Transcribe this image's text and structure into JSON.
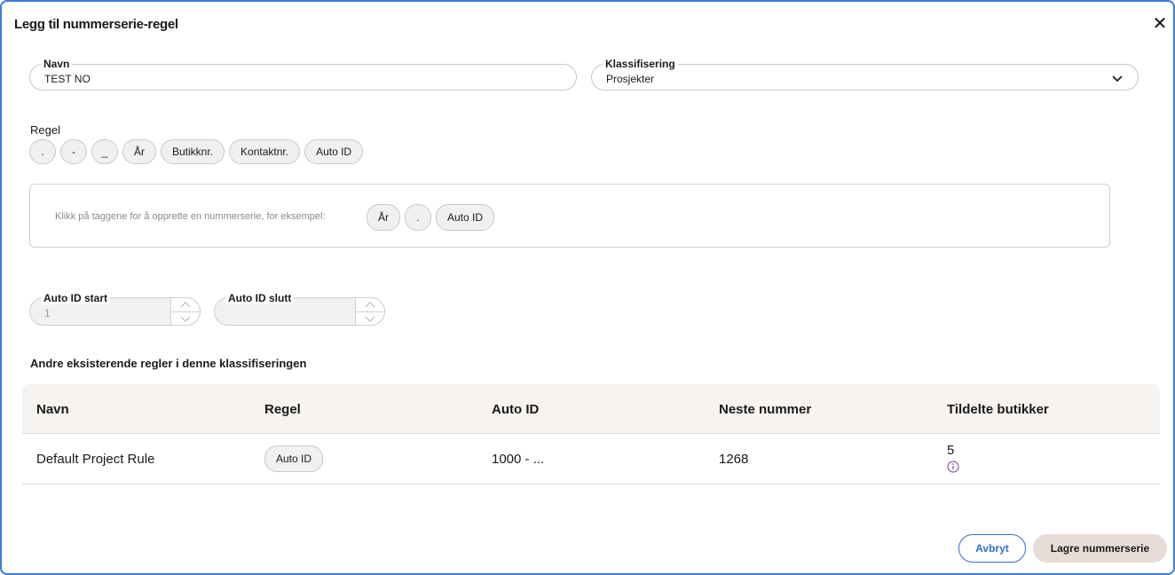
{
  "dialog": {
    "title": "Legg til nummerserie-regel",
    "close_icon": "close-icon"
  },
  "form": {
    "name": {
      "label": "Navn",
      "value": "TEST NO"
    },
    "classification": {
      "label": "Klassifisering",
      "value": "Prosjekter"
    }
  },
  "rule": {
    "label": "Regel",
    "tags": [
      ".",
      "-",
      "_",
      "År",
      "Butikknr.",
      "Kontaktnr.",
      "Auto ID"
    ],
    "hint": "Klikk på taggene for å opprette en nummerserie, for eksempel:",
    "example_tags": [
      "År",
      ".",
      "Auto ID"
    ]
  },
  "auto_id": {
    "start": {
      "label": "Auto ID start",
      "placeholder": "1"
    },
    "end": {
      "label": "Auto ID slutt",
      "placeholder": ""
    }
  },
  "existing": {
    "title": "Andre eksisterende regler i denne klassifiseringen",
    "columns": [
      "Navn",
      "Regel",
      "Auto ID",
      "Neste nummer",
      "Tildelte butikker"
    ],
    "rows": [
      {
        "name": "Default Project Rule",
        "rule": "Auto ID",
        "auto_id": "1000 - ...",
        "next": "1268",
        "stores": "5"
      }
    ]
  },
  "buttons": {
    "cancel": "Avbryt",
    "save": "Lagre nummerserie"
  },
  "colors": {
    "accent": "#2f6fd6",
    "border": "#3b7be0",
    "save_bg": "#e7ddd6",
    "info_icon": "#7a3aa8"
  }
}
